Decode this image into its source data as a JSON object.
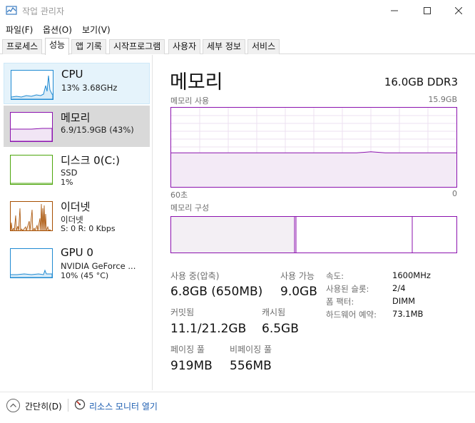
{
  "window": {
    "title": "작업 관리자",
    "icons": {
      "app": "task-manager-icon",
      "minimize": "minimize-icon",
      "maximize": "maximize-icon",
      "close": "close-icon"
    }
  },
  "menu": [
    "파일(F)",
    "옵션(O)",
    "보기(V)"
  ],
  "tabs": [
    "프로세스",
    "성능",
    "앱 기록",
    "시작프로그램",
    "사용자",
    "세부 정보",
    "서비스"
  ],
  "active_tab": "성능",
  "sidebar": {
    "items": [
      {
        "title": "CPU",
        "sub1": "13% 3.68GHz",
        "sub2": "",
        "color": "#1f8ad2",
        "state": "hover"
      },
      {
        "title": "메모리",
        "sub1": "6.9/15.9GB (43%)",
        "sub2": "",
        "color": "#8b12ae",
        "state": "selected"
      },
      {
        "title": "디스크 0(C:)",
        "sub1": "SSD",
        "sub2": "1%",
        "color": "#4da60c",
        "state": ""
      },
      {
        "title": "이더넷",
        "sub1": "이더넷",
        "sub2": "S: 0 R: 0 Kbps",
        "color": "#a74f01",
        "state": ""
      },
      {
        "title": "GPU 0",
        "sub1": "NVIDIA GeForce ...",
        "sub2": "10% (45 °C)",
        "color": "#1f8ad2",
        "state": ""
      }
    ]
  },
  "main": {
    "title": "메모리",
    "spec": "16.0GB DDR3",
    "usage_label": "메모리 사용",
    "usage_max": "15.9GB",
    "axis_left": "60초",
    "axis_right": "0",
    "usage_level": 0.43,
    "composition_label": "메모리 구성",
    "accent_color": "#8b12ae",
    "stats": {
      "in_use_label": "사용 중(압축)",
      "in_use_value": "6.8GB (650MB)",
      "available_label": "사용 가능",
      "available_value": "9.0GB",
      "committed_label": "커밋됨",
      "committed_value": "11.1/21.2GB",
      "cached_label": "캐시됨",
      "cached_value": "6.5GB",
      "paged_label": "페이징 풀",
      "paged_value": "919MB",
      "nonpaged_label": "비페이징 풀",
      "nonpaged_value": "556MB"
    },
    "props": {
      "speed_label": "속도:",
      "speed_value": "1600MHz",
      "slots_label": "사용된 슬롯:",
      "slots_value": "2/4",
      "form_label": "폼 팩터:",
      "form_value": "DIMM",
      "reserved_label": "하드웨어 예약:",
      "reserved_value": "73.1MB"
    }
  },
  "footer": {
    "fewer_label": "간단히(D)",
    "resmon_label": "리소스 모니터 열기",
    "icons": {
      "fewer": "chevron-up-icon",
      "resmon": "resource-monitor-icon"
    }
  }
}
